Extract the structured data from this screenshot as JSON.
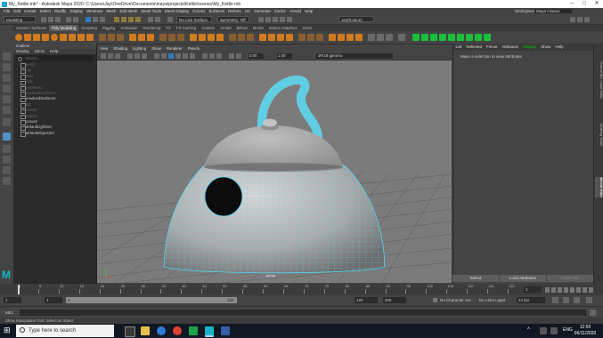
{
  "titlebar": {
    "title": "My_Kettle.mb* - Autodesk Maya 2020: C:\\Users\\Jay\\OneDrive\\Documents\\maya\\projects\\Kettle\\scenes\\My_Kettle.mb"
  },
  "menubar": {
    "items": [
      "File",
      "Edit",
      "Create",
      "Select",
      "Modify",
      "Display",
      "Windows",
      "Mesh",
      "Edit Mesh",
      "Mesh Tools",
      "Mesh Display",
      "Curves",
      "Surfaces",
      "Deform",
      "UV",
      "Generate",
      "Cache",
      "Arnold",
      "Help"
    ],
    "workspace_label": "Workspace :",
    "workspace_value": "Maya Classic"
  },
  "statusline": {
    "mode": "Modeling",
    "surface": "No Live Surface",
    "symmetry": "Symmetry: Off",
    "user": "Jay(ft.arjun)"
  },
  "shelf_tabs": [
    "Curves / Surfaces",
    "Poly Modeling",
    "Sculpting",
    "Rigging",
    "Animation",
    "Rendering",
    "FX",
    "FX Caching",
    "Custom",
    "Arnold",
    "Bifrost",
    "MASH",
    "Motion Graphics",
    "XGen"
  ],
  "shelf_active": "Poly Modeling",
  "outliner": {
    "menu": [
      "Display",
      "Show",
      "Help"
    ],
    "title": "Outliner",
    "search_placeholder": "Search...",
    "items": [
      {
        "name": "persp",
        "visible": false
      },
      {
        "name": "top",
        "visible": false
      },
      {
        "name": "front",
        "visible": false
      },
      {
        "name": "side",
        "visible": false
      },
      {
        "name": "pSphere1",
        "visible": false
      },
      {
        "name": "revolvedSurface1",
        "visible": false
      },
      {
        "name": "revolvedSurface2",
        "visible": true
      },
      {
        "name": "lid1",
        "visible": false
      },
      {
        "name": "handle",
        "visible": false
      },
      {
        "name": "bottom",
        "visible": false
      },
      {
        "name": "curve2",
        "visible": true
      },
      {
        "name": "defaultLightSet",
        "visible": true
      },
      {
        "name": "defaultObjectSet",
        "visible": true
      }
    ]
  },
  "viewport": {
    "menu": [
      "View",
      "Shading",
      "Lighting",
      "Show",
      "Renderer",
      "Panels"
    ],
    "gamma_value": "0.00",
    "gamma_scale": "1.00",
    "colorspace": "sRGB gamma",
    "camera_label": "persp"
  },
  "attribute_editor": {
    "tabs": [
      "List",
      "Selected",
      "Focus",
      "Attributes",
      "Display",
      "Show",
      "Help"
    ],
    "active_tab": "Display",
    "message": "Make a selection to view attributes",
    "buttons": [
      "Select",
      "Load Attributes",
      "Copy Tab"
    ],
    "side_tabs": [
      "Channel Box / Layer Editor",
      "Modeling Toolkit",
      "Attribute Editor"
    ]
  },
  "timeline": {
    "ticks": [
      "1",
      "5",
      "10",
      "15",
      "20",
      "25",
      "30",
      "35",
      "40",
      "45",
      "50",
      "55",
      "60",
      "65",
      "70",
      "75",
      "80",
      "85",
      "90",
      "95",
      "100",
      "105",
      "110",
      "115",
      "120"
    ],
    "current_frame": "1"
  },
  "range": {
    "start": "1",
    "start_inner": "1",
    "end_inner": "120",
    "end": "120",
    "end_outer": "200",
    "character_set": "No Character Set",
    "anim_layer": "No Anim Layer",
    "fps": "24 fps"
  },
  "cmdline": {
    "label": "MEL"
  },
  "helpline": {
    "text": "Show Manipulator Tool: Select an object"
  },
  "taskbar": {
    "search_placeholder": "Type here to search",
    "time": "12:55",
    "date": "06/11/2020",
    "lang": "ENG"
  },
  "colors": {
    "accent_green": "#1cbf3a",
    "wire_cyan": "#4fd6f0",
    "selection_blue": "#5290c6"
  }
}
